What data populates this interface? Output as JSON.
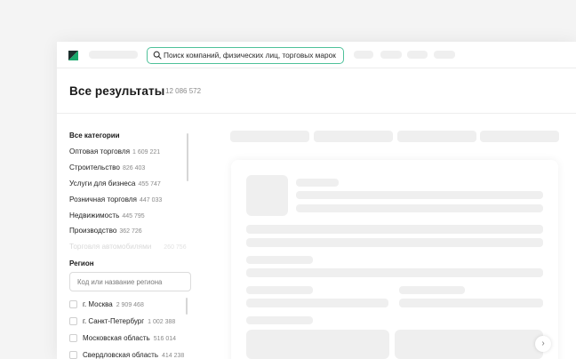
{
  "header": {
    "search_placeholder": "Поиск компаний, физических лиц, торговых марок"
  },
  "main": {
    "title": "Все результаты",
    "total_count": "12 086 572"
  },
  "categories": {
    "heading": "Все категории",
    "items": [
      {
        "label": "Оптовая торговля",
        "count": "1 609 221"
      },
      {
        "label": "Строительство",
        "count": "826 403"
      },
      {
        "label": "Услуги для бизнеса",
        "count": "455 747"
      },
      {
        "label": "Розничная торговля",
        "count": "447 033"
      },
      {
        "label": "Недвижимость",
        "count": "445 795"
      },
      {
        "label": "Производство",
        "count": "362 726"
      },
      {
        "label": "Торговля автомобилями",
        "count": "260 756"
      }
    ]
  },
  "region": {
    "heading": "Регион",
    "input_placeholder": "Код или название региона",
    "items": [
      {
        "label": "г. Москва",
        "count": "2 909 468"
      },
      {
        "label": "г. Санкт-Петербург",
        "count": "1 002 388"
      },
      {
        "label": "Московская область",
        "count": "516 014"
      },
      {
        "label": "Свердловская область",
        "count": "414 238"
      }
    ]
  },
  "icons": {
    "logo": "logo-icon",
    "search": "search-icon",
    "next": "chevron-right-icon"
  },
  "colors": {
    "accent": "#4fc19a",
    "logo_dark": "#1d2f2d",
    "logo_green": "#17a86b",
    "skeleton": "#efefef"
  }
}
